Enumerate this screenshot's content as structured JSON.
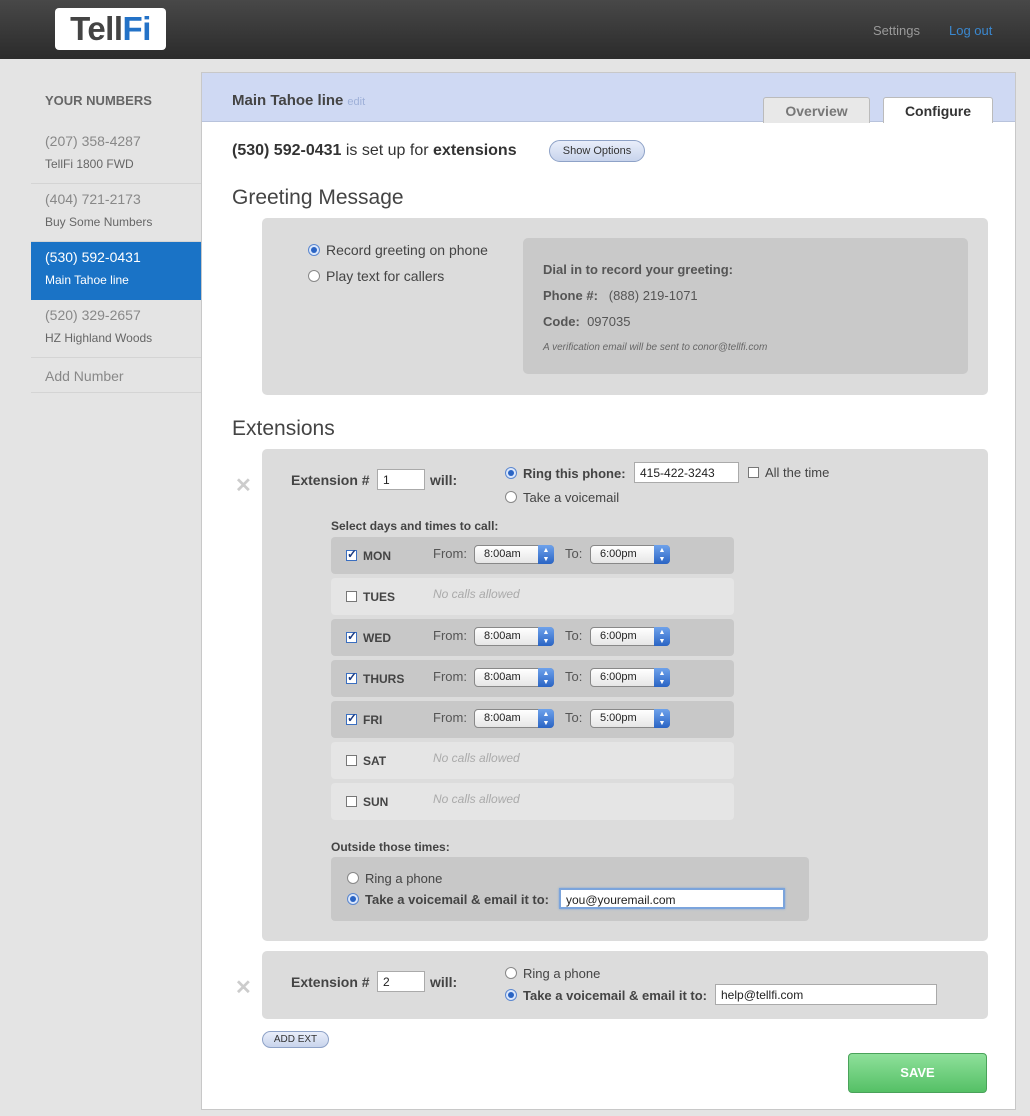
{
  "brand": {
    "logo_a": "Tell",
    "logo_b": "Fi",
    "accent": "#2372c7"
  },
  "topnav": {
    "settings": "Settings",
    "logout": "Log out"
  },
  "sidebar": {
    "heading": "YOUR NUMBERS",
    "items": [
      {
        "number": "(207) 358-4287",
        "label": "TellFi 1800 FWD"
      },
      {
        "number": "(404) 721-2173",
        "label": "Buy Some Numbers"
      },
      {
        "number": "(530) 592-0431",
        "label": "Main Tahoe line"
      },
      {
        "number": "(520) 329-2657",
        "label": "HZ Highland Woods"
      }
    ],
    "add": "Add Number"
  },
  "panel": {
    "title": "Main Tahoe line",
    "edit": "edit",
    "tabs": [
      "Overview",
      "Configure"
    ],
    "setup_number": "(530) 592-0431",
    "setup_text": " is set up for ",
    "setup_mode": "extensions",
    "show_options": "Show Options"
  },
  "greeting": {
    "heading": "Greeting Message",
    "opt_record": "Record greeting on phone",
    "opt_text": "Play text for callers",
    "dial_title": "Dial in to record your greeting:",
    "phone_label": "Phone #:",
    "phone_value": "(888) 219-1071",
    "code_label": "Code:",
    "code_value": "097035",
    "note": "A verification email will be sent to conor@tellfi.com"
  },
  "extensions": {
    "heading": "Extensions",
    "ext_label": "Extension #",
    "will": "will:",
    "ext1": {
      "num": "1",
      "ring_this": "Ring this phone:",
      "phone": "415-422-3243",
      "all_time": "All the time",
      "voicemail": "Take a voicemail",
      "select_days": "Select days and times to call:",
      "from": "From:",
      "to": "To:",
      "no_calls": "No calls allowed",
      "days": [
        {
          "name": "MON",
          "on": true,
          "from": "8:00am",
          "to": "6:00pm"
        },
        {
          "name": "TUES",
          "on": false
        },
        {
          "name": "WED",
          "on": true,
          "from": "8:00am",
          "to": "6:00pm"
        },
        {
          "name": "THURS",
          "on": true,
          "from": "8:00am",
          "to": "6:00pm"
        },
        {
          "name": "FRI",
          "on": true,
          "from": "8:00am",
          "to": "5:00pm"
        },
        {
          "name": "SAT",
          "on": false
        },
        {
          "name": "SUN",
          "on": false
        }
      ],
      "outside": "Outside those times:",
      "outside_ring": "Ring a phone",
      "outside_vm": "Take a voicemail & email it to:",
      "outside_email": "you@youremail.com"
    },
    "ext2": {
      "num": "2",
      "ring": "Ring a phone",
      "vm": "Take a voicemail & email it to:",
      "email": "help@tellfi.com"
    },
    "add_ext": "ADD EXT"
  },
  "save": "SAVE"
}
